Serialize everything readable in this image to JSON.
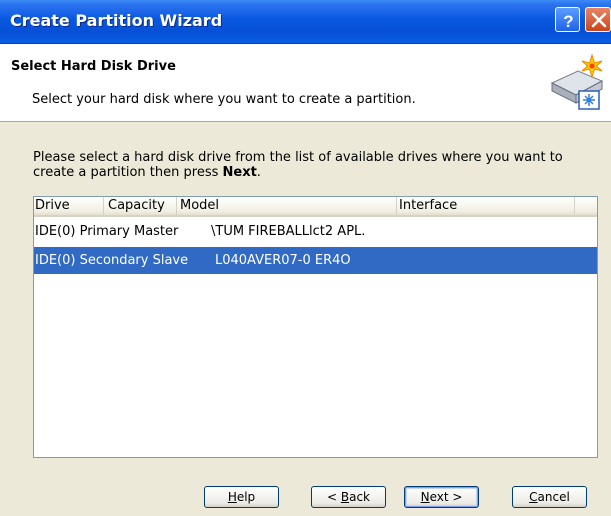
{
  "window": {
    "title": "Create Partition Wizard"
  },
  "header": {
    "title": "Select Hard Disk Drive",
    "subtitle": "Select your hard disk where you want to create a partition."
  },
  "instructions": {
    "text_before": "Please select a hard disk drive from the list of available drives where you want to create a partition then press ",
    "bold": "Next",
    "text_after": "."
  },
  "list": {
    "columns": [
      "Drive",
      "Capacity",
      "Model",
      "Interface"
    ],
    "rows": [
      {
        "drive": "IDE(0) Primary Master",
        "capacity": "",
        "model": "\\TUM FIREBALLlct2 APL.",
        "interface": "",
        "selected": false
      },
      {
        "drive": "IDE(0) Secondary Slave",
        "capacity": "",
        "model": "L040AVER07-0 ER4O",
        "interface": "",
        "selected": true
      }
    ]
  },
  "buttons": {
    "help": {
      "prefix": "",
      "mnemonic": "H",
      "suffix": "elp"
    },
    "back": {
      "prefix": "< ",
      "mnemonic": "B",
      "suffix": "ack"
    },
    "next": {
      "prefix": "",
      "mnemonic": "N",
      "suffix": "ext >"
    },
    "cancel": {
      "prefix": "",
      "mnemonic": "C",
      "suffix": "ancel"
    }
  },
  "colors": {
    "titlebar": "#0a58e0",
    "selection": "#316ac5",
    "dialog_bg": "#ece9d8"
  },
  "icons": [
    "help-icon",
    "close-icon",
    "hard-disk-wizard-icon"
  ]
}
